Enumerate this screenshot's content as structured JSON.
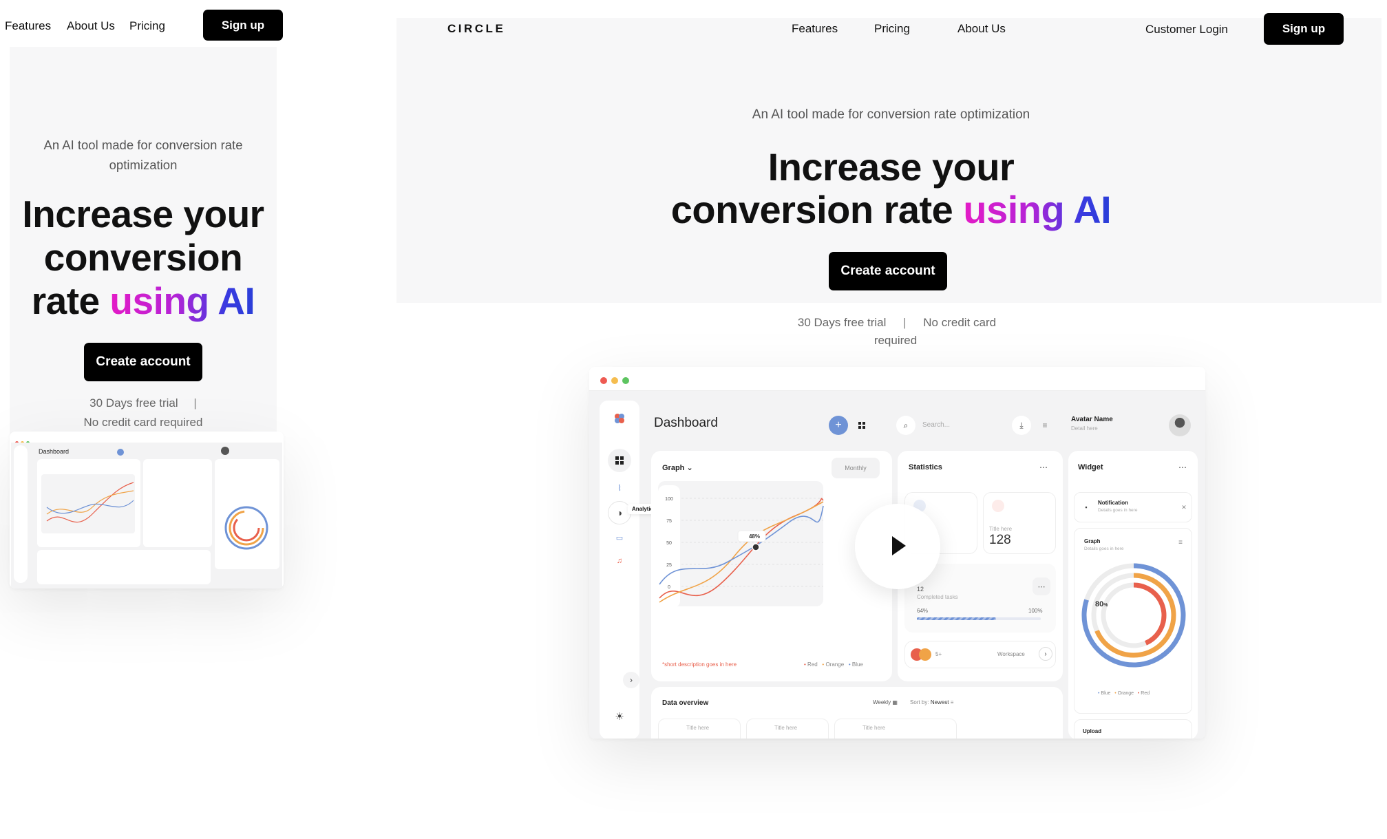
{
  "mobile": {
    "nav": {
      "features": "Features",
      "about": "About Us",
      "pricing": "Pricing",
      "signup": "Sign up"
    },
    "hero": {
      "subtitle": "An AI tool made for conversion rate optimization",
      "title_l1": "Increase your",
      "title_l2": "conversion",
      "title_l3a": "rate ",
      "title_l3b": "using AI",
      "cta": "Create account",
      "trial": "30 Days free trial",
      "separator": "|",
      "no_card": "No credit card required"
    }
  },
  "desktop": {
    "logo": "CIRCLE",
    "nav": {
      "features": "Features",
      "pricing": "Pricing",
      "about": "About Us",
      "login": "Customer Login",
      "signup": "Sign up"
    },
    "hero": {
      "subtitle": "An AI tool made for conversion rate optimization",
      "title_l1": "Increase your",
      "title_l2a": "conversion rate ",
      "title_l2b": "using AI",
      "cta": "Create account",
      "trial": "30 Days free trial",
      "separator": "|",
      "no_card_a": "No credit card",
      "no_card_b": "required"
    }
  },
  "dashboard": {
    "title": "Dashboard",
    "search_placeholder": "Search...",
    "avatar_name": "Avatar Name",
    "avatar_detail": "Detail here",
    "sidebar_tooltip": "Analytics",
    "graph": {
      "title": "Graph",
      "period": "Monthly",
      "ticks": [
        "100",
        "75",
        "50",
        "25",
        "0"
      ],
      "callout": "48",
      "callout_unit": "%",
      "footnote": "*short description goes in here",
      "legend": [
        "Red",
        "Orange",
        "Blue"
      ]
    },
    "statistics": {
      "title": "Statistics",
      "tile_label": "Title here",
      "tile_value": "128",
      "tasks_label": "Completed tasks",
      "tasks_value": "12",
      "progress_start": "64%",
      "progress_end": "100%",
      "progress_fraction": 0.64,
      "more_count": "5+",
      "workspace": "Workspace"
    },
    "widget": {
      "title": "Widget",
      "notif_title": "Notification",
      "notif_detail": "Details goes in here",
      "graph_title": "Graph",
      "graph_detail": "Details goes in here",
      "ring_value": "80",
      "ring_unit": "%",
      "legend": [
        "Blue",
        "Orange",
        "Red"
      ],
      "upload": "Upload"
    },
    "data_overview": {
      "title": "Data overview",
      "period": "Weekly",
      "sort_prefix": "Sort by:",
      "sort_value": "Newest",
      "cards": [
        "Title here",
        "Title here",
        "Title here"
      ]
    },
    "colors": {
      "red": "#e8604c",
      "orange": "#f0a347",
      "blue": "#6f93d6",
      "accent": "#6f93d6"
    }
  }
}
